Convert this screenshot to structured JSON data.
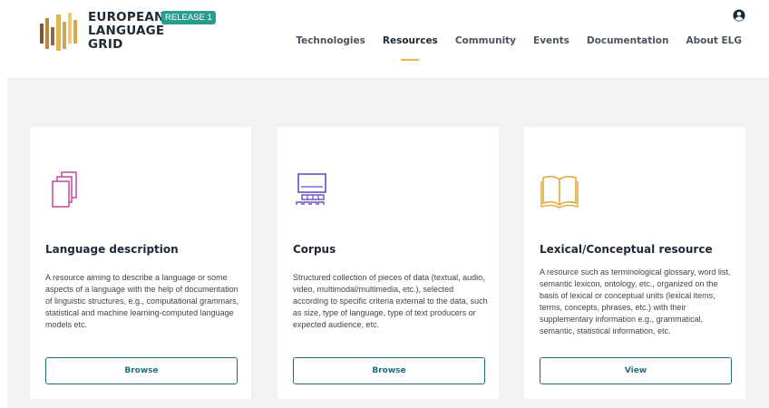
{
  "header": {
    "logo": {
      "line1": "EUROPEAN",
      "line2": "LANGUAGE",
      "line3": "GRID",
      "badge": "RELEASE 1"
    },
    "nav": [
      {
        "label": "Technologies"
      },
      {
        "label": "Resources",
        "active": true
      },
      {
        "label": "Community"
      },
      {
        "label": "Events"
      },
      {
        "label": "Documentation"
      },
      {
        "label": "About ELG"
      }
    ],
    "user_icon": "user-circle-icon"
  },
  "cards": [
    {
      "icon": "stacked-pages-icon",
      "icon_color": "#c2549d",
      "title": "Language description",
      "description": "A resource aiming to describe a language or some aspects of a language with the help of documentation of linguistic structures, e.g., computational grammars, statistical and machine learning-computed language models etc.",
      "button": "Browse"
    },
    {
      "icon": "corpus-screen-icon",
      "icon_color": "#6a4cc2",
      "title": "Corpus",
      "description": "Structured collection of pieces of data (textual, audio, video, multimodal/multimedia, etc.), selected according to specific criteria external to the data, such as size, type of language, type of text producers or expected audience, etc.",
      "button": "Browse"
    },
    {
      "icon": "open-book-icon",
      "icon_color": "#e0a93a",
      "title": "Lexical/Conceptual resource",
      "description": "A resource such as terminological glossary, word list, semantic lexicon, ontology, etc., organized on the basis of lexical or conceptual units (lexical items, terms, concepts, phrases, etc.) with their supplementary information e.g., grammatical, semantic, statistical information, etc.",
      "button": "View"
    }
  ],
  "colors": {
    "accent": "#1f6f7a",
    "badge": "#2a9d8f",
    "nav_underline": "#e6b84a",
    "band_background": "#f2f2f2"
  }
}
